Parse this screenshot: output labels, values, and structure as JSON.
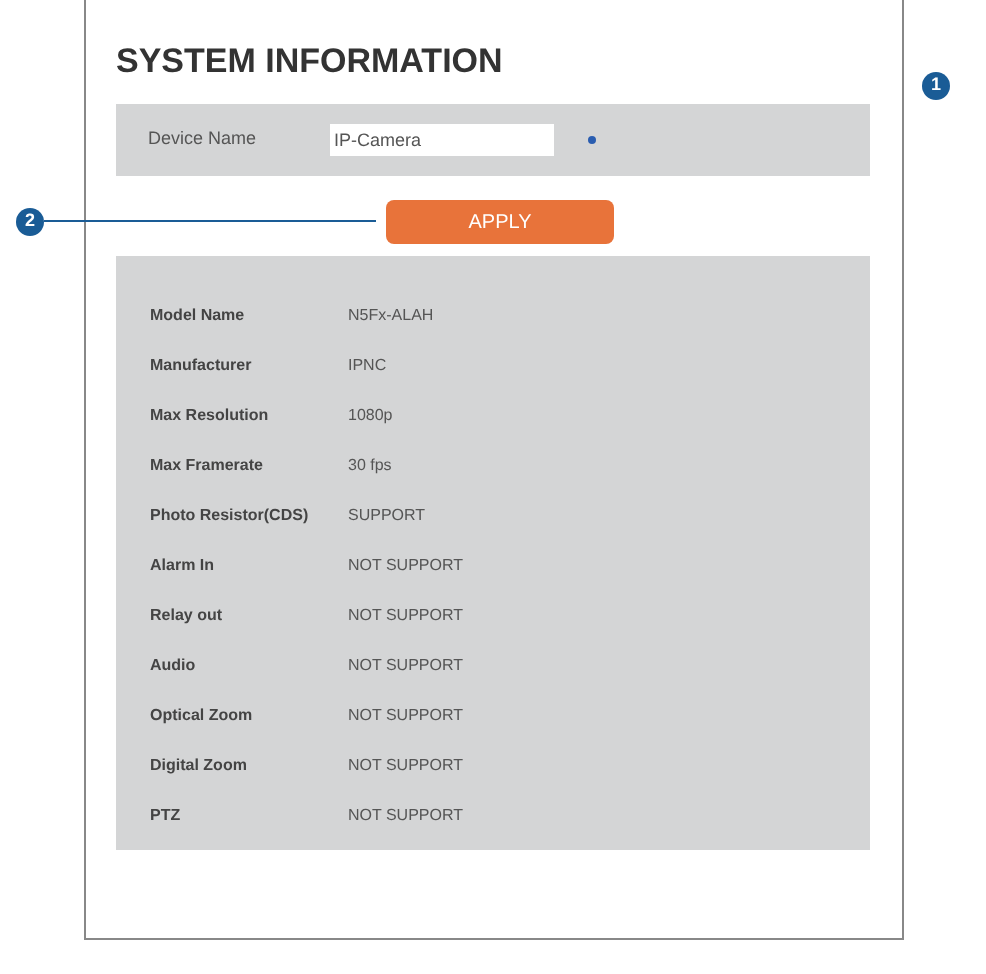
{
  "title": "SYSTEM INFORMATION",
  "device_name": {
    "label": "Device Name",
    "value": "IP-Camera"
  },
  "apply_button": "APPLY",
  "callouts": [
    "1",
    "2"
  ],
  "info_rows": [
    {
      "label": "Model Name",
      "value": "N5Fx-ALAH"
    },
    {
      "label": "Manufacturer",
      "value": "IPNC"
    },
    {
      "label": "Max Resolution",
      "value": "1080p"
    },
    {
      "label": "Max Framerate",
      "value": "30 fps"
    },
    {
      "label": "Photo Resistor(CDS)",
      "value": "SUPPORT"
    },
    {
      "label": "Alarm In",
      "value": "NOT SUPPORT"
    },
    {
      "label": "Relay out",
      "value": "NOT SUPPORT"
    },
    {
      "label": "Audio",
      "value": "NOT SUPPORT"
    },
    {
      "label": "Optical Zoom",
      "value": "NOT SUPPORT"
    },
    {
      "label": "Digital Zoom",
      "value": "NOT SUPPORT"
    },
    {
      "label": "PTZ",
      "value": "NOT SUPPORT"
    }
  ]
}
